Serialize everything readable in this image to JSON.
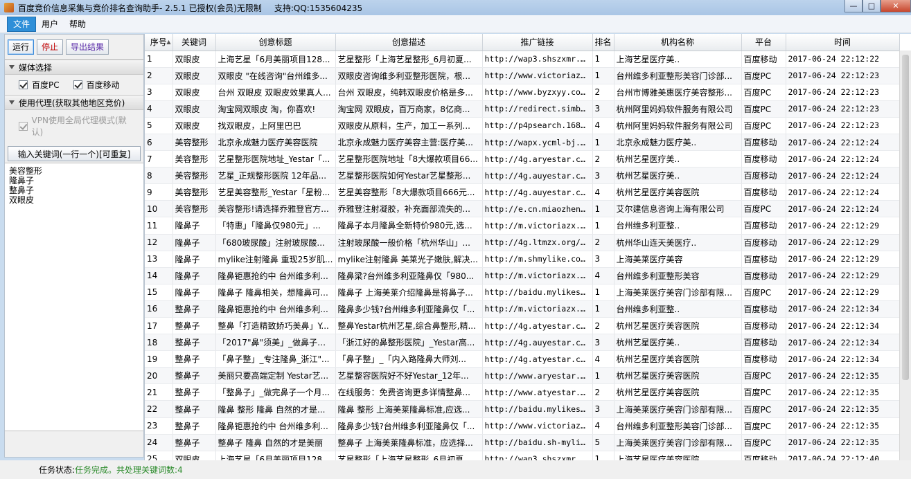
{
  "window": {
    "title": "百度竞价信息采集与竞价排名查询助手- 2.5.1 已授权(会员)无限制",
    "support": "支持:QQ:1535604235"
  },
  "menu": [
    "文件",
    "用户",
    "帮助"
  ],
  "toolbar": {
    "run": "运行",
    "stop": "停止",
    "export": "导出结果"
  },
  "media": {
    "header": "媒体选择",
    "baidu_pc": "百度PC",
    "baidu_mobile": "百度移动"
  },
  "proxy": {
    "header": "使用代理(获取其他地区竞价)",
    "vpn": "VPN使用全局代理模式(默认)"
  },
  "keywords": {
    "header": "输入关键词(一行一个)[可重复]",
    "list": [
      "美容整形",
      "隆鼻子",
      "整鼻子",
      "双眼皮"
    ]
  },
  "table": {
    "columns": [
      "序号",
      "关键词",
      "创意标题",
      "创意描述",
      "推广链接",
      "排名",
      "机构名称",
      "平台",
      "时间"
    ],
    "rows": [
      [
        "1",
        "双眼皮",
        "上海艺星「6月美丽项目128...",
        "艺星整形「上海艺星整形_6月初夏...",
        "http://wap3.shszxmr.c...",
        "1",
        "上海艺星医疗美..",
        "百度移动",
        "2017-06-24 22:12:22"
      ],
      [
        "2",
        "双眼皮",
        "双眼皮 \"在线咨询\"台州维多...",
        "双眼皮咨询维多利亚整形医院，根...",
        "http://www.victoriazx...",
        "1",
        "台州维多利亚整形美容门诊部...",
        "百度PC",
        "2017-06-24 22:12:23"
      ],
      [
        "3",
        "双眼皮",
        "台州 双眼皮 双眼皮效果真人...",
        "台州 双眼皮，纯韩双眼皮价格是多...",
        "http://www.byzxyy.co...",
        "2",
        "台州市博雅美惠医疗美容整形...",
        "百度PC",
        "2017-06-24 22:12:23"
      ],
      [
        "4",
        "双眼皮",
        "淘宝网双眼皮 淘，你喜欢!",
        "淘宝网 双眼皮，百万商家，8亿商...",
        "http://redirect.simba.t...",
        "3",
        "杭州阿里妈妈软件服务有限公司",
        "百度PC",
        "2017-06-24 22:12:23"
      ],
      [
        "5",
        "双眼皮",
        "找双眼皮，上阿里巴巴",
        "双眼皮从原料，生产，加工一系列...",
        "http://p4psearch.1688...",
        "4",
        "杭州阿里妈妈软件服务有限公司",
        "百度PC",
        "2017-06-24 22:12:23"
      ],
      [
        "6",
        "美容整形",
        "北京永成魅力医疗美容医院",
        "北京永成魅力医疗美容主营:医疗美...",
        "http://wapx.ycml-bj.co...",
        "1",
        "北京永成魅力医疗美..",
        "百度移动",
        "2017-06-24 22:12:24"
      ],
      [
        "7",
        "美容整形",
        "艺星整形医院地址_Yestar「...",
        "艺星整形医院地址「8大爆款项目66...",
        "http://4g.aryestar.com...",
        "2",
        "杭州艺星医疗美..",
        "百度移动",
        "2017-06-24 22:12:24"
      ],
      [
        "8",
        "美容整形",
        "艺星_正规整形医院 12年品...",
        "艺星整形医院如何Yestar艺星整形...",
        "http://4g.auyestar.com...",
        "3",
        "杭州艺星医疗美..",
        "百度移动",
        "2017-06-24 22:12:24"
      ],
      [
        "9",
        "美容整形",
        "艺星美容整形_Yestar「星粉...",
        "艺星美容整形「8大爆款项目666元...",
        "http://4g.auyestar.com...",
        "4",
        "杭州艺星医疗美容医院",
        "百度移动",
        "2017-06-24 22:12:24"
      ],
      [
        "10",
        "美容整形",
        "美容整形!请选择乔雅登官方...",
        "乔雅登注射凝胶，补充面部流失的...",
        "http://e.cn.miaozhen.c...",
        "1",
        "艾尔建信息咨询上海有限公司",
        "百度PC",
        "2017-06-24 22:12:24"
      ],
      [
        "11",
        "隆鼻子",
        "「特惠」「隆鼻仅980元」...",
        "隆鼻子本月隆鼻全新特价980元,选...",
        "http://m.victoriazx.co...",
        "1",
        "台州维多利亚整..",
        "百度移动",
        "2017-06-24 22:12:29"
      ],
      [
        "12",
        "隆鼻子",
        "「680玻尿酸」注射玻尿酸...",
        "注射玻尿酸一般价格「杭州华山」...",
        "http://4g.ltmzx.org/hs...",
        "2",
        "杭州华山连天美医疗..",
        "百度移动",
        "2017-06-24 22:12:29"
      ],
      [
        "13",
        "隆鼻子",
        "mylike注射隆鼻 重现25岁肌...",
        "mylike注射隆鼻 美莱光子嫩肤,解决...",
        "http://m.shmylike.com...",
        "3",
        "上海美莱医疗美容",
        "百度移动",
        "2017-06-24 22:12:29"
      ],
      [
        "14",
        "隆鼻子",
        "隆鼻钜惠抢约中 台州维多利...",
        "隆鼻梁?台州维多利亚隆鼻仅「980...",
        "http://m.victoriazx.co...",
        "4",
        "台州维多利亚整形美容",
        "百度移动",
        "2017-06-24 22:12:29"
      ],
      [
        "15",
        "隆鼻子",
        "隆鼻子 隆鼻相关，想隆鼻可...",
        "隆鼻子 上海美莱介绍隆鼻是将鼻子...",
        "http://baidu.mylikesh.c...",
        "1",
        "上海美莱医疗美容门诊部有限...",
        "百度PC",
        "2017-06-24 22:12:29"
      ],
      [
        "16",
        "整鼻子",
        "隆鼻钜惠抢约中 台州维多利...",
        "隆鼻多少钱?台州维多利亚隆鼻仅「...",
        "http://m.victoriazx.co...",
        "1",
        "台州维多利亚整..",
        "百度移动",
        "2017-06-24 22:12:34"
      ],
      [
        "17",
        "整鼻子",
        "整鼻「打造精致娇巧美鼻」Y...",
        "整鼻Yestar杭州艺星,综合鼻整形,精...",
        "http://4g.atyestar.com...",
        "2",
        "杭州艺星医疗美容医院",
        "百度移动",
        "2017-06-24 22:12:34"
      ],
      [
        "18",
        "整鼻子",
        "「2017\"鼻\"须美」_做鼻子哪...",
        "「浙江好的鼻整形医院」_Yestar高...",
        "http://4g.auyestar.com...",
        "3",
        "杭州艺星医疗美..",
        "百度移动",
        "2017-06-24 22:12:34"
      ],
      [
        "19",
        "整鼻子",
        "「鼻子整」_专注隆鼻_浙江\"...",
        "「鼻子整」_「内入路隆鼻大师刘...",
        "http://4g.atyestar.com...",
        "4",
        "杭州艺星医疗美容医院",
        "百度移动",
        "2017-06-24 22:12:34"
      ],
      [
        "20",
        "整鼻子",
        "美丽只要高端定制 Yestar艺...",
        "艺星整容医院好不好Yestar_12年...",
        "http://www.aryestar.co...",
        "1",
        "杭州艺星医疗美容医院",
        "百度PC",
        "2017-06-24 22:12:35"
      ],
      [
        "21",
        "整鼻子",
        "「整鼻子」_做完鼻子一个月...",
        "在线服务：免费咨询更多详情整鼻...",
        "http://www.atyestar.co...",
        "2",
        "杭州艺星医疗美容医院",
        "百度PC",
        "2017-06-24 22:12:35"
      ],
      [
        "22",
        "整鼻子",
        "隆鼻 整形 隆鼻 自然的才是...",
        "隆鼻 整形 上海美莱隆鼻标准,应选...",
        "http://baidu.mylikesh.c...",
        "3",
        "上海美莱医疗美容门诊部有限...",
        "百度PC",
        "2017-06-24 22:12:35"
      ],
      [
        "23",
        "整鼻子",
        "隆鼻钜惠抢约中 台州维多利...",
        "隆鼻多少钱?台州维多利亚隆鼻仅「...",
        "http://www.victoriazx...",
        "4",
        "台州维多利亚整形美容门诊部...",
        "百度PC",
        "2017-06-24 22:12:35"
      ],
      [
        "24",
        "整鼻子",
        "整鼻子 隆鼻 自然的才是美丽",
        "整鼻子 上海美莱隆鼻标准，应选择...",
        "http://baidu.sh-mylike...",
        "5",
        "上海美莱医疗美容门诊部有限...",
        "百度PC",
        "2017-06-24 22:12:35"
      ],
      [
        "25",
        "双眼皮",
        "上海艺星「6月美丽项目128...",
        "艺星整形「上海艺星整形_6月初夏...",
        "http://wap3.shszxmr.c...",
        "1",
        "上海艺星医疗美容医院",
        "百度移动",
        "2017-06-24 22:12:40"
      ]
    ]
  },
  "status": {
    "label": "任务状态:",
    "value": "任务完成。共处理关键词数:4"
  }
}
